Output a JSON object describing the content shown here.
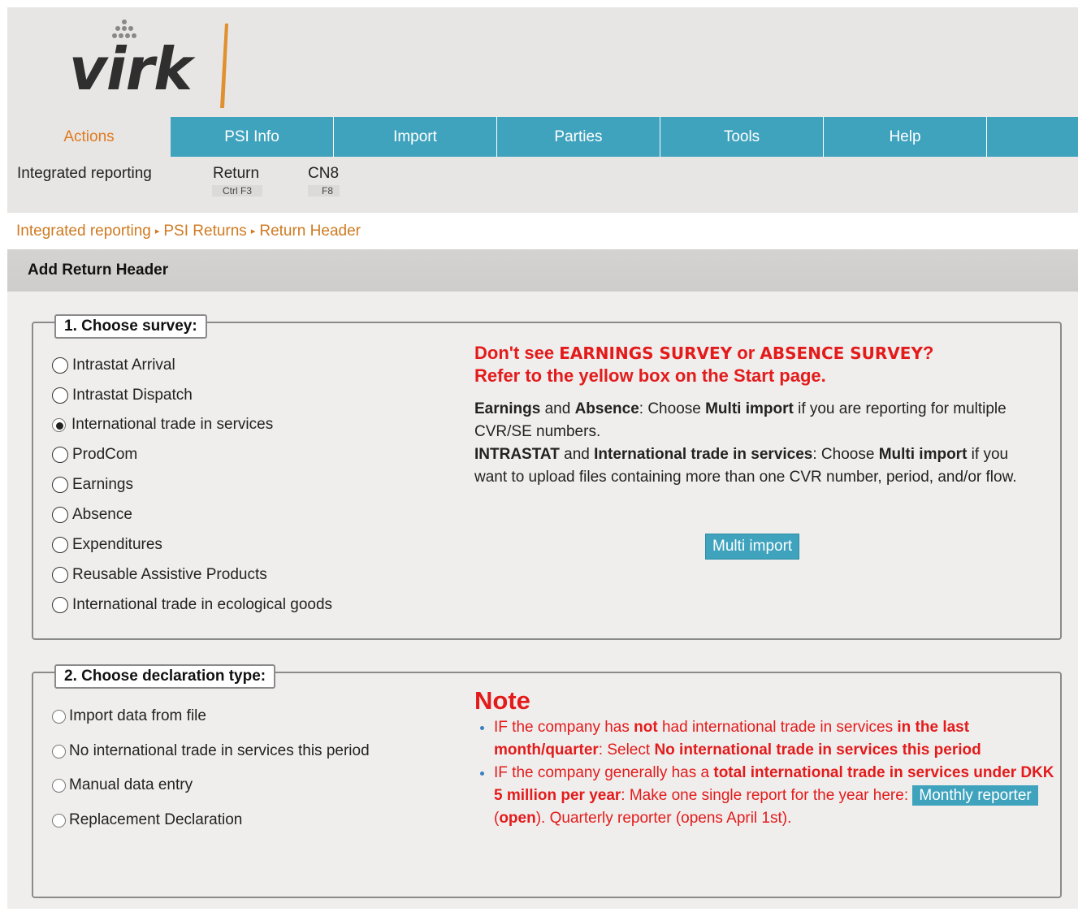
{
  "brand": {
    "logo_text": "virk",
    "colors": {
      "accent_teal": "#3fa3be",
      "accent_orange": "#e07a1f",
      "alert_red": "#e31b1b"
    }
  },
  "nav": {
    "tabs": [
      {
        "label": "Actions",
        "active": true
      },
      {
        "label": "PSI Info"
      },
      {
        "label": "Import"
      },
      {
        "label": "Parties"
      },
      {
        "label": "Tools"
      },
      {
        "label": "Help"
      }
    ]
  },
  "subnav": {
    "items": [
      {
        "label": "Integrated reporting",
        "shortcut": ""
      },
      {
        "label": "Return",
        "shortcut": "Ctrl F3"
      },
      {
        "label": "CN8",
        "shortcut": "F8"
      }
    ]
  },
  "breadcrumb": [
    "Integrated reporting",
    "PSI Returns",
    "Return Header"
  ],
  "section_title": "Add Return Header",
  "survey": {
    "legend": "1. Choose survey:",
    "options": [
      {
        "label": "Intrastat Arrival",
        "checked": false
      },
      {
        "label": "Intrastat Dispatch",
        "checked": false
      },
      {
        "label": "International trade in services",
        "checked": true
      },
      {
        "label": "ProdCom",
        "checked": false
      },
      {
        "label": "Earnings",
        "checked": false
      },
      {
        "label": "Absence",
        "checked": false
      },
      {
        "label": "Expenditures",
        "checked": false
      },
      {
        "label": "Reusable Assistive Products",
        "checked": false
      },
      {
        "label": "International trade in ecological goods",
        "checked": false
      }
    ],
    "warning": {
      "line1_a": "Don't see ",
      "line1_b": "EARNINGS SURVEY",
      "line1_c": " or ",
      "line1_d": "ABSENCE SURVEY",
      "line1_e": "?",
      "line2": "Refer to the yellow box on the Start page."
    },
    "info": {
      "p1_b1": "Earnings",
      "p1_t1": " and ",
      "p1_b2": "Absence",
      "p1_t2": ": Choose ",
      "p1_b3": "Multi import",
      "p1_t3": " if you are reporting for multiple CVR/SE numbers.",
      "p2_b1": "INTRASTAT",
      "p2_t1": " and ",
      "p2_b2": "International trade in services",
      "p2_t2": ": Choose ",
      "p2_b3": "Multi import",
      "p2_t3": " if you want to upload files containing more than one CVR number, period, and/or flow."
    },
    "multi_import_label": "Multi import"
  },
  "declaration": {
    "legend": "2. Choose declaration type:",
    "options": [
      {
        "label": "Import data from file"
      },
      {
        "label": "No international trade in services this period"
      },
      {
        "label": "Manual data entry"
      },
      {
        "label": "Replacement Declaration"
      }
    ],
    "note_title": "Note",
    "note1": {
      "t1": "IF the company has ",
      "b1": "not",
      "t2": " had international trade in services ",
      "b2": "in the last month/quarter",
      "t3": ": Select ",
      "b3": "No international trade in services this period"
    },
    "note2": {
      "t1": "IF the company generally has a ",
      "b1": "total international trade in services under DKK 5 million per year",
      "t2": ": Make one single report for the year here: ",
      "btn": "Monthly reporter",
      "t3": " (",
      "b2": "open",
      "t4": "). Quarterly reporter (opens April 1st)."
    }
  }
}
